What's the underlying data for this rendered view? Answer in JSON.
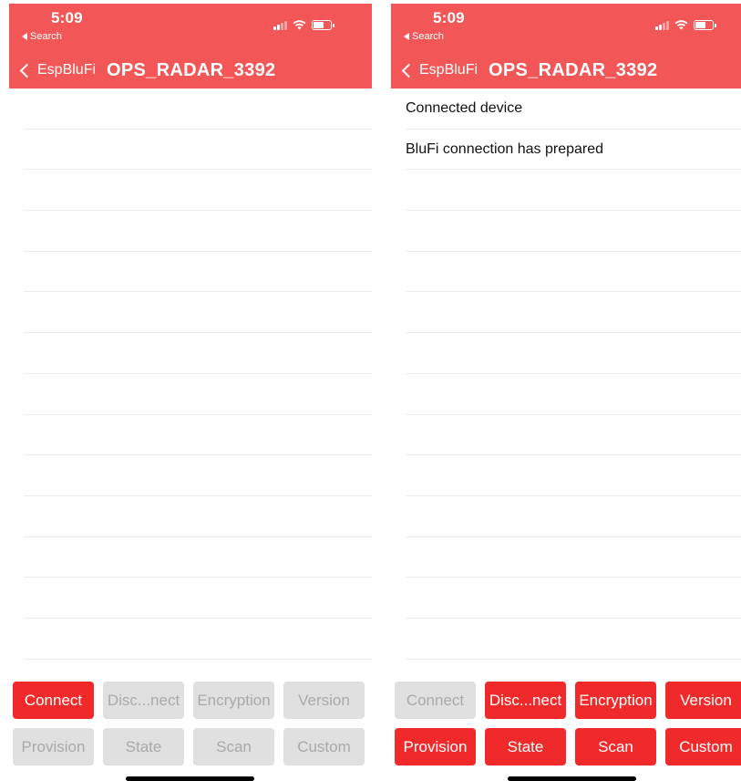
{
  "left": {
    "status": {
      "time": "5:09",
      "back_app": "Search"
    },
    "nav": {
      "back_label": "EspBluFi",
      "title": "OPS_RADAR_3392"
    },
    "rows": [
      "",
      "",
      "",
      "",
      "",
      "",
      "",
      "",
      "",
      "",
      "",
      "",
      "",
      ""
    ],
    "buttons": [
      {
        "label": "Connect",
        "enabled": true
      },
      {
        "label": "Disc...nect",
        "enabled": false
      },
      {
        "label": "Encryption",
        "enabled": false
      },
      {
        "label": "Version",
        "enabled": false
      },
      {
        "label": "Provision",
        "enabled": false
      },
      {
        "label": "State",
        "enabled": false
      },
      {
        "label": "Scan",
        "enabled": false
      },
      {
        "label": "Custom",
        "enabled": false
      }
    ]
  },
  "right": {
    "status": {
      "time": "5:09",
      "back_app": "Search"
    },
    "nav": {
      "back_label": "EspBluFi",
      "title": "OPS_RADAR_3392"
    },
    "rows": [
      "Connected device",
      "BluFi connection has prepared",
      "",
      "",
      "",
      "",
      "",
      "",
      "",
      "",
      "",
      "",
      "",
      ""
    ],
    "buttons": [
      {
        "label": "Connect",
        "enabled": false
      },
      {
        "label": "Disc...nect",
        "enabled": true
      },
      {
        "label": "Encryption",
        "enabled": true
      },
      {
        "label": "Version",
        "enabled": true
      },
      {
        "label": "Provision",
        "enabled": true
      },
      {
        "label": "State",
        "enabled": true
      },
      {
        "label": "Scan",
        "enabled": true
      },
      {
        "label": "Custom",
        "enabled": true
      }
    ]
  },
  "colors": {
    "header": "#f25656",
    "button_enabled": "#f02a2a",
    "button_disabled": "#e0e0e0",
    "button_disabled_text": "#aaaaaa"
  },
  "icons": [
    "signal-icon",
    "wifi-icon",
    "battery-icon",
    "chevron-left-icon",
    "back-triangle-icon"
  ]
}
